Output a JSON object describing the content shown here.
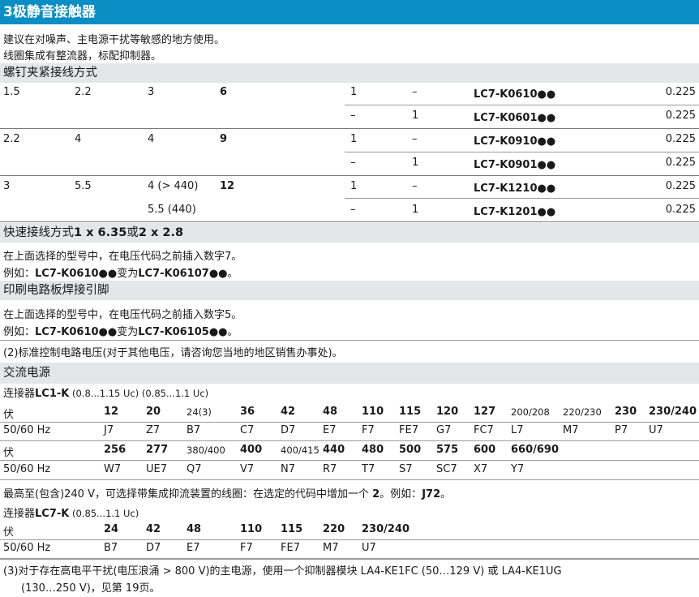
{
  "title": "3极静音接触器",
  "intro": {
    "line1": "建议在对噪声、主电源干扰等敏感的地方使用。",
    "line2": "线圈集成有整流器，标配抑制器。"
  },
  "screw": {
    "heading": "螺钉夹紧接线方式",
    "rows": [
      {
        "c1": "1.5",
        "c2": "2.2",
        "c3": "3",
        "c4": "6",
        "n1": "1",
        "n2": "–",
        "ref": "LC7-K0610●●",
        "w": "0.225"
      },
      {
        "c1": "",
        "c2": "",
        "c3": "",
        "c4": "",
        "n1": "–",
        "n2": "1",
        "ref": "LC7-K0601●●",
        "w": "0.225"
      },
      {
        "c1": "2.2",
        "c2": "4",
        "c3": "4",
        "c4": "9",
        "n1": "1",
        "n2": "–",
        "ref": "LC7-K0910●●",
        "w": "0.225"
      },
      {
        "c1": "",
        "c2": "",
        "c3": "",
        "c4": "",
        "n1": "–",
        "n2": "1",
        "ref": "LC7-K0901●●",
        "w": "0.225"
      },
      {
        "c1": "3",
        "c2": "5.5",
        "c3": "4 (> 440)",
        "c4": "12",
        "n1": "1",
        "n2": "–",
        "ref": "LC7-K1210●●",
        "w": "0.225"
      },
      {
        "c1": "",
        "c2": "",
        "c3": "5.5 (440)",
        "c4": "",
        "n1": "–",
        "n2": "1",
        "ref": "LC7-K1201●●",
        "w": "0.225"
      }
    ]
  },
  "quick": {
    "heading_pre": "快速接线方式",
    "heading_bold": "1 x 6.35",
    "heading_mid": "或",
    "heading_bold2": "2 x 2.8",
    "line1": "在上面选择的型号中，在电压代码之前插入数字7。",
    "example_pre": "例如：",
    "example_a": "LC7-K0610●●",
    "example_mid": "变为",
    "example_b": "LC7-K06107●●",
    "example_end": "。"
  },
  "pcb": {
    "heading": "印刷电路板焊接引脚",
    "line1": "在上面选择的型号中，在电压代码之前插入数字5。",
    "example_pre": "例如：",
    "example_a": "LC7-K0610●●",
    "example_mid": "变为",
    "example_b": "LC7-K06105●●",
    "example_end": "。"
  },
  "note2": "(2)标准控制电路电压(对于其他电压，请咨询您当地的地区销售办事处)。",
  "ac": {
    "heading": "交流电源",
    "sub1_pre": "连接器",
    "sub1_bold": "LC1-K",
    "sub1_rest": " (0.8...1.15 Uc) (0.85...1.1 Uc)",
    "row_v_label": "伏",
    "row_hz_label": "50/60 Hz",
    "table1_v": [
      "12",
      "20",
      "24(3)",
      "36",
      "42",
      "48",
      "110",
      "115",
      "120",
      "127",
      "200/208",
      "220/230",
      "230",
      "230/240"
    ],
    "table1_c": [
      "J7",
      "Z7",
      "B7",
      "C7",
      "D7",
      "E7",
      "F7",
      "FE7",
      "G7",
      "FC7",
      "L7",
      "M7",
      "P7",
      "U7"
    ],
    "table2_v": [
      "256",
      "277",
      "380/400",
      "400",
      "400/415",
      "440",
      "480",
      "500",
      "575",
      "600",
      "660/690"
    ],
    "table2_c": [
      "W7",
      "UE7",
      "Q7",
      "V7",
      "N7",
      "R7",
      "T7",
      "S7",
      "SC7",
      "X7",
      "Y7"
    ],
    "note_pre": "最高至(包含)240 V，可选择带集成抑流装置的线圈：在选定的代码中增加一个 ",
    "note_b1": "2",
    "note_mid": "。例如：",
    "note_b2": "J72",
    "note_end": "。",
    "sub2_pre": "连接器",
    "sub2_bold": "LC7-K",
    "sub2_rest": " (0.85...1.1 Uc)",
    "table3_v": [
      "24",
      "42",
      "48",
      "110",
      "115",
      "220",
      "230/240"
    ],
    "table3_c": [
      "B7",
      "D7",
      "E7",
      "F7",
      "FE7",
      "M7",
      "U7"
    ]
  },
  "note3": {
    "line1": "(3)对于存在高电平干扰(电压浪涌 > 800 V)的主电源，使用一个抑制器模块 LA4-KE1FC (50…129 V) 或 LA4-KE1UG",
    "line2": "(130…250 V)，见第 19页。"
  }
}
